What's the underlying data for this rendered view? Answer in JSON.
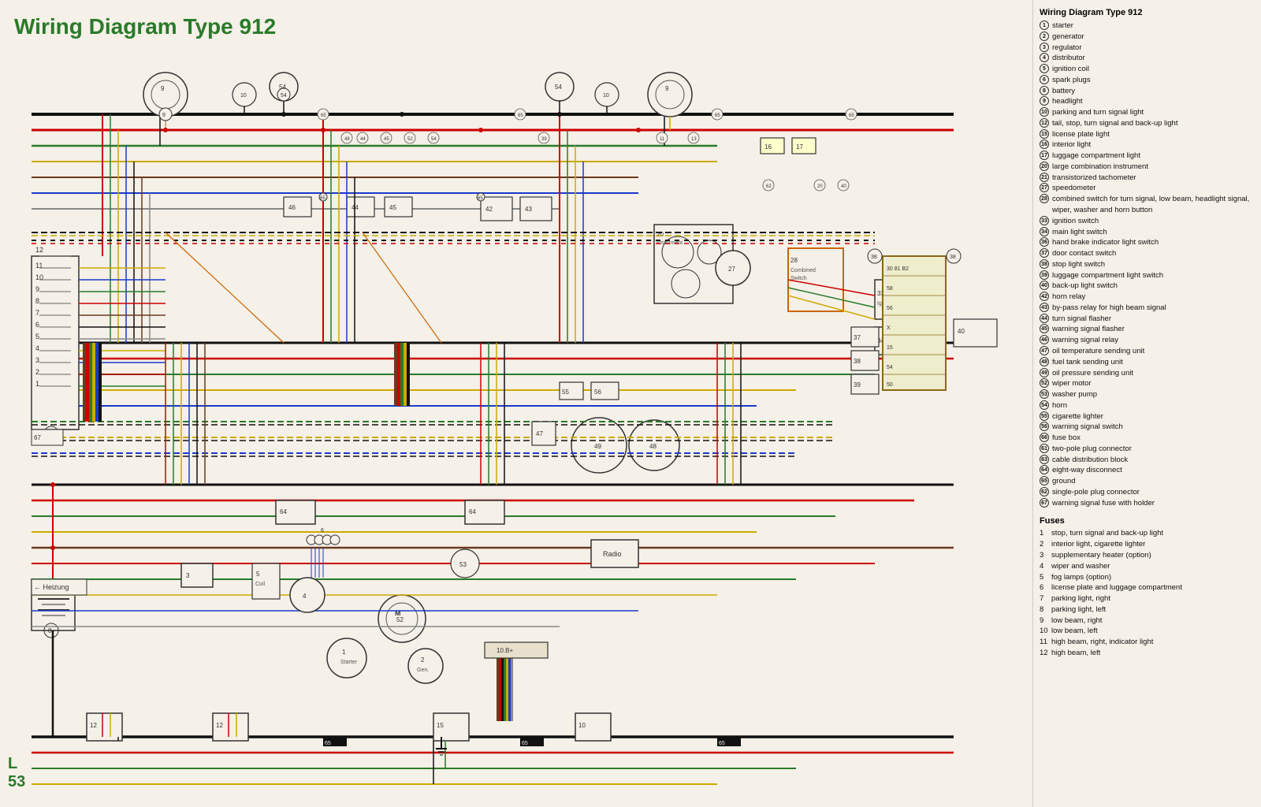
{
  "title": "Wiring Diagram Type 912",
  "page_label": "L\n53",
  "legend": {
    "title": "Wiring Diagram Type 912",
    "items": [
      {
        "num": "1",
        "label": "starter"
      },
      {
        "num": "2",
        "label": "generator"
      },
      {
        "num": "3",
        "label": "regulator"
      },
      {
        "num": "4",
        "label": "distributor"
      },
      {
        "num": "5",
        "label": "ignition coil"
      },
      {
        "num": "6",
        "label": "spark plugs"
      },
      {
        "num": "8",
        "label": "battery"
      },
      {
        "num": "9",
        "label": "headlight"
      },
      {
        "num": "10",
        "label": "parking and turn signal light"
      },
      {
        "num": "12",
        "label": "tail, stop, turn signal and back-up light"
      },
      {
        "num": "15",
        "label": "license plate light"
      },
      {
        "num": "16",
        "label": "interior light"
      },
      {
        "num": "17",
        "label": "luggage compartment light"
      },
      {
        "num": "20",
        "label": "large combination instrument"
      },
      {
        "num": "21",
        "label": "transistorized tachometer"
      },
      {
        "num": "27",
        "label": "speedometer"
      },
      {
        "num": "28",
        "label": "combined switch for turn signal, low beam, headlight signal, wiper, washer and horn button"
      },
      {
        "num": "33",
        "label": "ignition switch"
      },
      {
        "num": "34",
        "label": "main light switch"
      },
      {
        "num": "36",
        "label": "hand brake indicator light switch"
      },
      {
        "num": "37",
        "label": "door contact switch"
      },
      {
        "num": "38",
        "label": "stop light switch"
      },
      {
        "num": "39",
        "label": "luggage compartment light switch"
      },
      {
        "num": "40",
        "label": "back-up light switch"
      },
      {
        "num": "42",
        "label": "horn relay"
      },
      {
        "num": "43",
        "label": "by-pass relay for high beam signal"
      },
      {
        "num": "44",
        "label": "turn signal flasher"
      },
      {
        "num": "45",
        "label": "warning signal flasher"
      },
      {
        "num": "46",
        "label": "warning signal relay"
      },
      {
        "num": "47",
        "label": "oil temperature sending unit"
      },
      {
        "num": "48",
        "label": "fuel tank sending unit"
      },
      {
        "num": "49",
        "label": "oil pressure sending unit"
      },
      {
        "num": "52",
        "label": "wiper motor"
      },
      {
        "num": "53",
        "label": "washer pump"
      },
      {
        "num": "54",
        "label": "horn"
      },
      {
        "num": "55",
        "label": "cigarette lighter"
      },
      {
        "num": "56",
        "label": "warning signal switch"
      },
      {
        "num": "66",
        "label": "fuse box"
      },
      {
        "num": "61",
        "label": "two-pole plug connector"
      },
      {
        "num": "63",
        "label": "cable distribution block"
      },
      {
        "num": "64",
        "label": "eight-way disconnect"
      },
      {
        "num": "65",
        "label": "ground"
      },
      {
        "num": "62",
        "label": "single-pole plug connector"
      },
      {
        "num": "67",
        "label": "warning signal fuse with holder"
      }
    ]
  },
  "fuses": {
    "title": "Fuses",
    "items": [
      {
        "num": "1",
        "label": "stop, turn signal and back-up light"
      },
      {
        "num": "2",
        "label": "interior light, cigarette lighter"
      },
      {
        "num": "3",
        "label": "supplementary heater (option)"
      },
      {
        "num": "4",
        "label": "wiper and washer"
      },
      {
        "num": "5",
        "label": "fog lamps (option)"
      },
      {
        "num": "6",
        "label": "license plate and luggage compartment"
      },
      {
        "num": "7",
        "label": "parking light, right"
      },
      {
        "num": "8",
        "label": "parking light, left"
      },
      {
        "num": "9",
        "label": "low beam, right"
      },
      {
        "num": "10",
        "label": "low beam, left"
      },
      {
        "num": "11",
        "label": "high beam, right, indicator light"
      },
      {
        "num": "12",
        "label": "high beam, left"
      }
    ]
  },
  "colors": {
    "title_green": "#2a7a2a",
    "bg": "#f5f0e8"
  }
}
